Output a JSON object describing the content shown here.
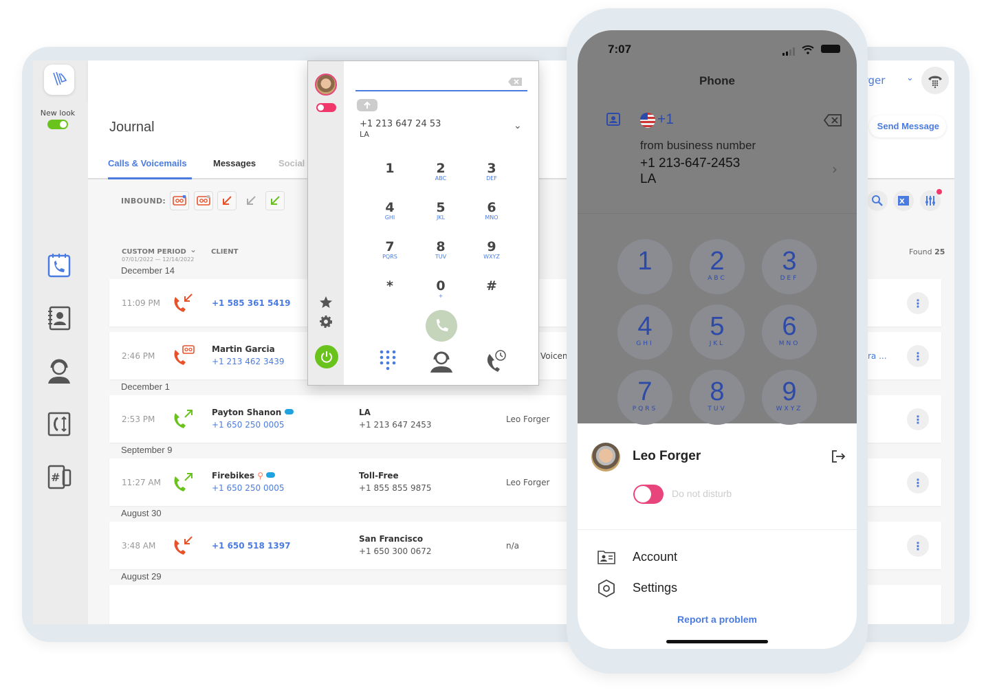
{
  "sidebar": {
    "new_look_label": "New look",
    "new_look_on": true,
    "items": [
      {
        "icon": "calendar-phone-icon",
        "active": true
      },
      {
        "icon": "contacts-book-icon"
      },
      {
        "icon": "operator-headset-icon"
      },
      {
        "icon": "call-routing-icon"
      },
      {
        "icon": "phone-number-icon"
      }
    ]
  },
  "header": {
    "user_name": "Leo Forger",
    "send_message_label": "Send Message"
  },
  "journal": {
    "title": "Journal",
    "tabs": [
      {
        "label": "Calls & Voicemails",
        "active": true
      },
      {
        "label": "Messages"
      },
      {
        "label": "Social"
      }
    ],
    "inbound_label": "INBOUND:",
    "filters": [
      "voicemail-new-icon",
      "voicemail-icon",
      "missed-call-icon",
      "incoming-call-icon",
      "answered-call-icon"
    ],
    "period_label": "CUSTOM PERIOD",
    "period_range": "07/01/2022 — 12/14/2022",
    "client_label": "CLIENT",
    "found_label": "Found",
    "found_count": "25",
    "groups": [
      {
        "date": "December 14",
        "rows": [
          {
            "time": "11:09 PM",
            "type": "missed",
            "number": "+1 585 361 5419"
          },
          {
            "time": "2:46 PM",
            "type": "voicemail",
            "name": "Martin Garcia",
            "number": "+1 213 462 3439",
            "extra": "Voicen",
            "extra_right": "ra ..."
          }
        ]
      },
      {
        "date": "December 1",
        "rows": [
          {
            "time": "2:53 PM",
            "type": "outbound",
            "name": "Payton Shanon",
            "number": "+1 650 250 0005",
            "crm": [
              "salesforce"
            ],
            "location": "LA",
            "location_number": "+1 213 647 2453",
            "agent": "Leo Forger"
          }
        ]
      },
      {
        "date": "September 9",
        "rows": [
          {
            "time": "11:27 AM",
            "type": "outbound",
            "name": "Firebikes",
            "number": "+1 650 250 0005",
            "crm": [
              "hubspot",
              "salesforce"
            ],
            "location": "Toll-Free",
            "location_number": "+1 855 855 9875",
            "agent": "Leo Forger"
          }
        ]
      },
      {
        "date": "August 30",
        "rows": [
          {
            "time": "3:48 AM",
            "type": "missed",
            "number": "+1 650 518 1397",
            "location": "San Francisco",
            "location_number": "+1 650 300 0672",
            "agent": "n/a"
          }
        ]
      },
      {
        "date": "August 29",
        "rows": []
      }
    ]
  },
  "dialer": {
    "caller_id": "+1 213 647 24 53",
    "caller_city": "LA",
    "dnd_on": true,
    "keys": [
      {
        "d": "1",
        "l": ""
      },
      {
        "d": "2",
        "l": "ABC"
      },
      {
        "d": "3",
        "l": "DEF"
      },
      {
        "d": "4",
        "l": "GHI"
      },
      {
        "d": "5",
        "l": "JKL"
      },
      {
        "d": "6",
        "l": "MNO"
      },
      {
        "d": "7",
        "l": "PQRS"
      },
      {
        "d": "8",
        "l": "TUV"
      },
      {
        "d": "9",
        "l": "WXYZ"
      },
      {
        "d": "*",
        "l": ""
      },
      {
        "d": "0",
        "l": "+"
      },
      {
        "d": "#",
        "l": ""
      }
    ]
  },
  "phone": {
    "time": "7:07",
    "title": "Phone",
    "country_code": "+1",
    "from_label": "from business number",
    "from_number": "+1 213-647-2453",
    "from_city": "LA",
    "keys": [
      {
        "d": "1",
        "l": ""
      },
      {
        "d": "2",
        "l": "ABC"
      },
      {
        "d": "3",
        "l": "DEF"
      },
      {
        "d": "4",
        "l": "GHI"
      },
      {
        "d": "5",
        "l": "JKL"
      },
      {
        "d": "6",
        "l": "MNO"
      },
      {
        "d": "7",
        "l": "PQRS"
      },
      {
        "d": "8",
        "l": "TUV"
      },
      {
        "d": "9",
        "l": "WXYZ"
      }
    ],
    "user_name": "Leo Forger",
    "dnd_label": "Do not disturb",
    "dnd_on": true,
    "menu": [
      {
        "label": "Account",
        "icon": "account-card-icon"
      },
      {
        "label": "Settings",
        "icon": "settings-hex-icon"
      }
    ],
    "report_label": "Report a problem"
  },
  "colors": {
    "accent": "#4a7be0",
    "missed": "#e8522a",
    "answered": "#6ac21c",
    "dnd": "#e8457c"
  }
}
